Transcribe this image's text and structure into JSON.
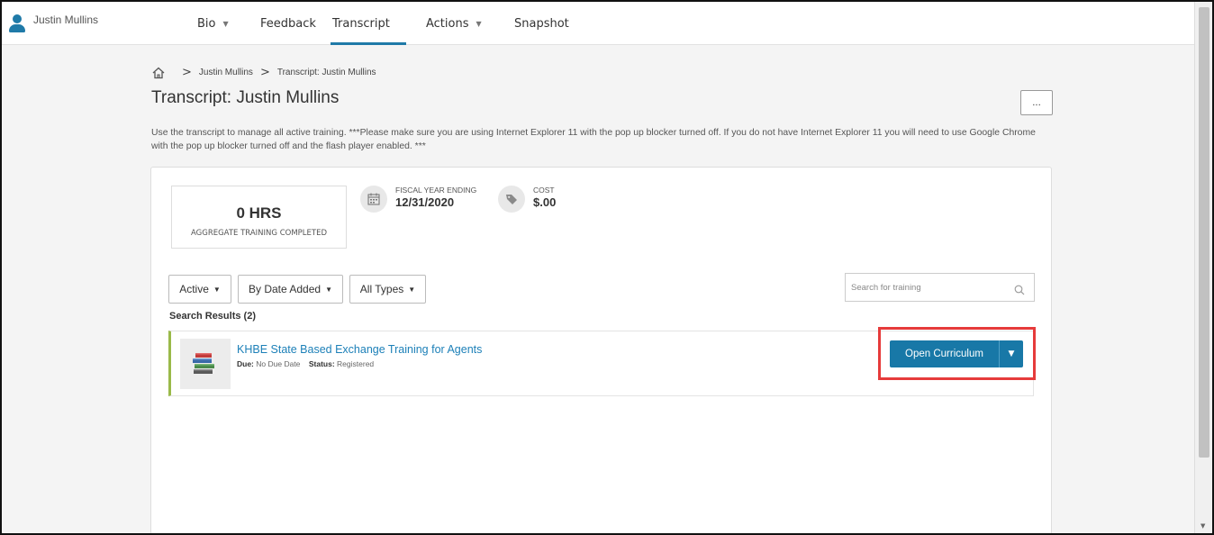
{
  "user": {
    "name": "Justin Mullins"
  },
  "nav": {
    "tabs": [
      {
        "label": "Bio",
        "has_dropdown": true
      },
      {
        "label": "Feedback",
        "has_dropdown": false
      },
      {
        "label": "Transcript",
        "has_dropdown": false,
        "active": true
      },
      {
        "label": "Actions",
        "has_dropdown": true
      },
      {
        "label": "Snapshot",
        "has_dropdown": false
      }
    ]
  },
  "breadcrumb": {
    "items": [
      "Justin Mullins",
      "Transcript: Justin Mullins"
    ]
  },
  "page": {
    "title": "Transcript: Justin Mullins",
    "more_label": "...",
    "description": "Use the transcript to manage all active training. ***Please make sure you are using Internet Explorer 11 with the pop up blocker turned off. If you do not have Internet Explorer 11 you will need to use Google Chrome with the pop up blocker turned off and the flash player enabled. ***"
  },
  "summary": {
    "hours_value": "0 HRS",
    "hours_label": "AGGREGATE TRAINING COMPLETED",
    "fiscal_label": "FISCAL YEAR ENDING",
    "fiscal_value": "12/31/2020",
    "cost_label": "COST",
    "cost_value": "$.00"
  },
  "filters": {
    "status": "Active",
    "sort": "By Date Added",
    "type": "All Types"
  },
  "search": {
    "placeholder": "Search for training"
  },
  "results": {
    "label": "Search Results (2)",
    "items": [
      {
        "title": "KHBE State Based Exchange Training for Agents",
        "due_label": "Due:",
        "due_value": "No Due Date",
        "status_label": "Status:",
        "status_value": "Registered",
        "action_label": "Open Curriculum"
      }
    ]
  },
  "colors": {
    "accent": "#1878a7",
    "link": "#1d80b8",
    "highlight": "#e63b3b",
    "row_marker": "#9aba4a"
  }
}
